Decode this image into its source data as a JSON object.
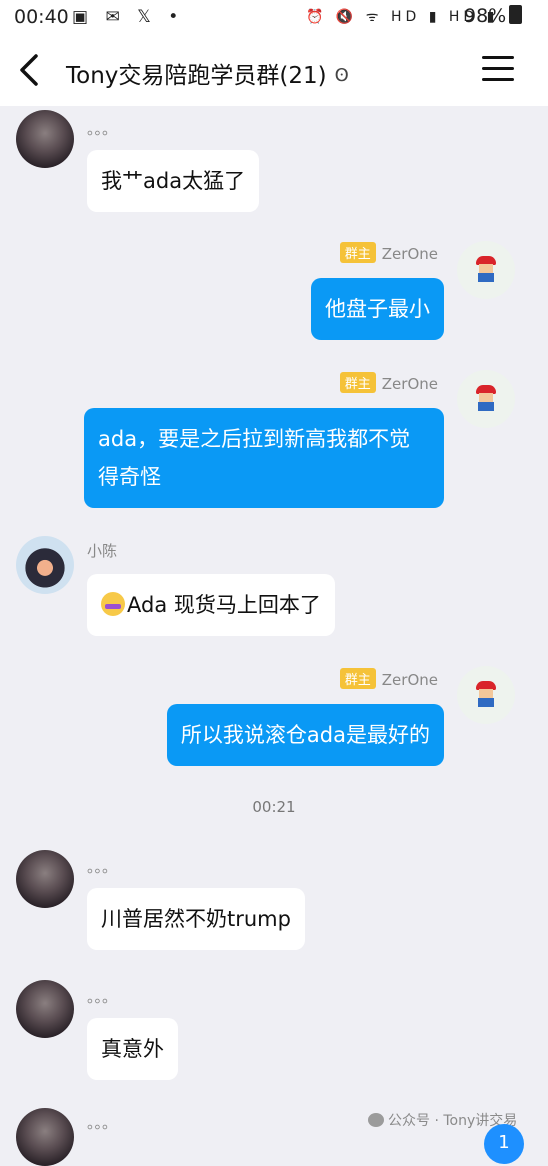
{
  "status_bar": {
    "time": "00:40",
    "left_icons": "▣ ✉ 𝕏 •",
    "right_icons": "⏰ 🔇 ᯤ HD ▮ HD ▮",
    "battery": "98%"
  },
  "header": {
    "title": "Tony交易陪跑学员群(21)",
    "ear_icon": "ʘ"
  },
  "messages": [
    {
      "side": "left",
      "sender": "。。。",
      "text": "我艹ada太猛了"
    },
    {
      "side": "right",
      "badge": "群主",
      "sender": "ZerOne",
      "text": "他盘子最小"
    },
    {
      "side": "right",
      "badge": "群主",
      "sender": "ZerOne",
      "text": "ada，要是之后拉到新高我都不觉得奇怪"
    },
    {
      "side": "left",
      "sender": "小陈",
      "text": "Ada 现货马上回本了"
    },
    {
      "side": "right",
      "badge": "群主",
      "sender": "ZerOne",
      "text": "所以我说滚仓ada是最好的"
    },
    {
      "side": "left",
      "sender": "。。。",
      "text": "川普居然不奶trump"
    },
    {
      "side": "left",
      "sender": "。。。",
      "text": "真意外"
    },
    {
      "side": "left",
      "sender": "。。。",
      "text": ""
    }
  ],
  "timestamp": "00:21",
  "watermark": "公众号 · Tony讲交易",
  "unread_count": "1"
}
